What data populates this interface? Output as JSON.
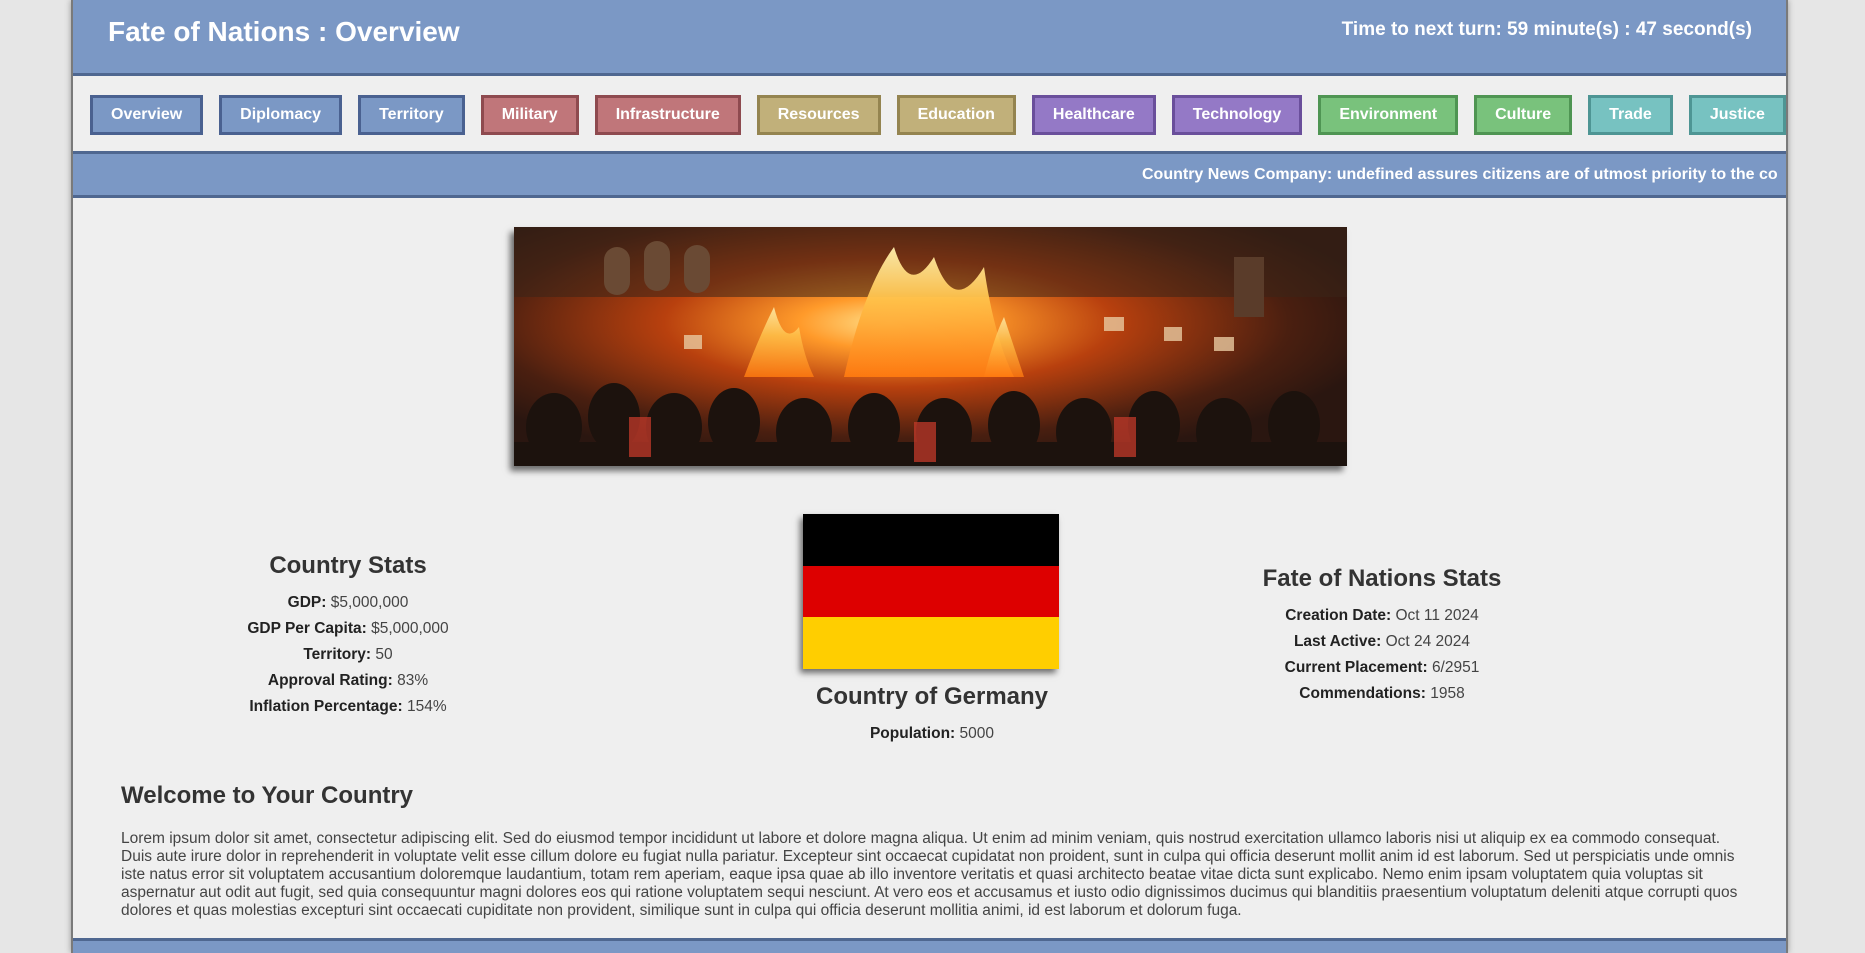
{
  "header": {
    "title": "Fate of Nations : Overview",
    "timer": "Time to next turn: 59 minute(s) : 47 second(s)"
  },
  "nav": {
    "items": [
      {
        "label": "Overview",
        "color": "#7b98c5"
      },
      {
        "label": "Diplomacy",
        "color": "#7b98c5"
      },
      {
        "label": "Territory",
        "color": "#7b98c5"
      },
      {
        "label": "Military",
        "color": "#c0767a"
      },
      {
        "label": "Infrastructure",
        "color": "#c0767a"
      },
      {
        "label": "Resources",
        "color": "#c1b07a"
      },
      {
        "label": "Education",
        "color": "#c1b07a"
      },
      {
        "label": "Healthcare",
        "color": "#9479c6"
      },
      {
        "label": "Technology",
        "color": "#9479c6"
      },
      {
        "label": "Environment",
        "color": "#79c27c"
      },
      {
        "label": "Culture",
        "color": "#79c27c"
      },
      {
        "label": "Trade",
        "color": "#77c2c1"
      },
      {
        "label": "Justice",
        "color": "#77c2c1"
      }
    ]
  },
  "ticker": {
    "text": "Country News Company: undefined assures citizens are of utmost priority to the country"
  },
  "country_stats": {
    "title": "Country Stats",
    "gdp_label": "GDP:",
    "gdp": "$5,000,000",
    "gdp_pc_label": "GDP Per Capita:",
    "gdp_pc": "$5,000,000",
    "territory_label": "Territory:",
    "territory": "50",
    "approval_label": "Approval Rating:",
    "approval": "83%",
    "inflation_label": "Inflation Percentage:",
    "inflation": "154%"
  },
  "country": {
    "name": "Country of Germany",
    "population_label": "Population:",
    "population": "5000",
    "flag_colors": [
      "#000000",
      "#dd0000",
      "#ffce00"
    ]
  },
  "fon_stats": {
    "title": "Fate of Nations Stats",
    "creation_label": "Creation Date:",
    "creation": "Oct 11 2024",
    "active_label": "Last Active:",
    "active": "Oct 24 2024",
    "placement_label": "Current Placement:",
    "placement": "6/2951",
    "commend_label": "Commendations:",
    "commend": "1958"
  },
  "welcome": {
    "title": "Welcome to Your Country",
    "body": "Lorem ipsum dolor sit amet, consectetur adipiscing elit. Sed do eiusmod tempor incididunt ut labore et dolore magna aliqua. Ut enim ad minim veniam, quis nostrud exercitation ullamco laboris nisi ut aliquip ex ea commodo consequat. Duis aute irure dolor in reprehenderit in voluptate velit esse cillum dolore eu fugiat nulla pariatur. Excepteur sint occaecat cupidatat non proident, sunt in culpa qui officia deserunt mollit anim id est laborum. Sed ut perspiciatis unde omnis iste natus error sit voluptatem accusantium doloremque laudantium, totam rem aperiam, eaque ipsa quae ab illo inventore veritatis et quasi architecto beatae vitae dicta sunt explicabo. Nemo enim ipsam voluptatem quia voluptas sit aspernatur aut odit aut fugit, sed quia consequuntur magni dolores eos qui ratione voluptatem sequi nesciunt. At vero eos et accusamus et iusto odio dignissimos ducimus qui blanditiis praesentium voluptatum deleniti atque corrupti quos dolores et quas molestias excepturi sint occaecati cupiditate non provident, similique sunt in culpa qui officia deserunt mollitia animi, id est laborum et dolorum fuga."
  }
}
